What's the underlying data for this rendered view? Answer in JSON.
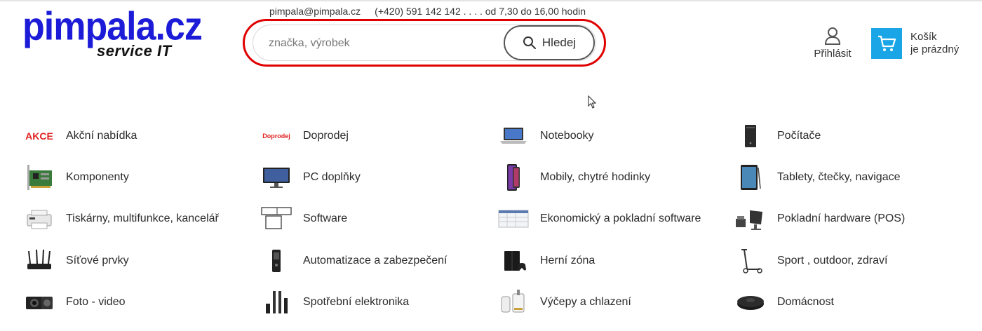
{
  "logo": {
    "main": "pimpala.cz",
    "sub": "service IT"
  },
  "contact": {
    "email": "pimpala@pimpala.cz",
    "phone_hours": "(+420) 591 142 142 . . . . od 7,30 do 16,00 hodin"
  },
  "search": {
    "placeholder": "značka, výrobek",
    "value": "",
    "button_label": "Hledej"
  },
  "account": {
    "login_label": "Přihlásit"
  },
  "cart": {
    "title": "Košík",
    "status": "je prázdný",
    "accent": "#1aa6e6"
  },
  "highlight_color": "#e00000",
  "categories": [
    {
      "label": "Akční nabídka",
      "thumb": "akce-badge",
      "badge_text": "AKCE"
    },
    {
      "label": "Doprodej",
      "thumb": "doprodej-badge",
      "badge_text": "Doprodej"
    },
    {
      "label": "Notebooky",
      "thumb": "notebook-icon"
    },
    {
      "label": "Počítače",
      "thumb": "pc-tower-icon"
    },
    {
      "label": "Komponenty",
      "thumb": "pcb-card-icon"
    },
    {
      "label": "PC doplňky",
      "thumb": "monitor-icon"
    },
    {
      "label": "Mobily, chytré hodinky",
      "thumb": "smartphone-icon"
    },
    {
      "label": "Tablety, čtečky, navigace",
      "thumb": "tablet-icon"
    },
    {
      "label": "Tiskárny, multifunkce, kancelář",
      "thumb": "printer-icon"
    },
    {
      "label": "Software",
      "thumb": "software-windows-icon"
    },
    {
      "label": "Ekonomický a pokladní software",
      "thumb": "spreadsheet-icon"
    },
    {
      "label": "Pokladní hardware (POS)",
      "thumb": "pos-terminal-icon"
    },
    {
      "label": "Síťové prvky",
      "thumb": "router-icon"
    },
    {
      "label": "Automatizace a zabezpečení",
      "thumb": "security-device-icon"
    },
    {
      "label": "Herní zóna",
      "thumb": "game-console-icon"
    },
    {
      "label": "Sport , outdoor, zdraví",
      "thumb": "scooter-icon"
    },
    {
      "label": "Foto - video",
      "thumb": "camera-icon"
    },
    {
      "label": "Spotřební elektronika",
      "thumb": "speakers-icon"
    },
    {
      "label": "Výčepy a chlazení",
      "thumb": "beer-tap-icon"
    },
    {
      "label": "Domácnost",
      "thumb": "robot-vacuum-icon"
    }
  ]
}
